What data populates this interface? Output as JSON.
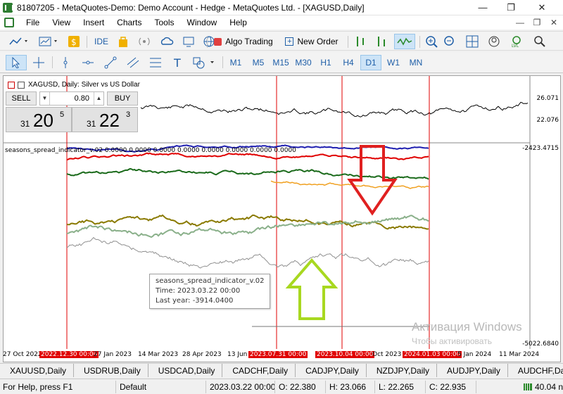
{
  "window": {
    "title": "81807205 - MetaQuotes-Demo: Demo Account - Hedge - MetaQuotes Ltd. - [XAGUSD,Daily]"
  },
  "menu": [
    "File",
    "View",
    "Insert",
    "Charts",
    "Tools",
    "Window",
    "Help"
  ],
  "toolbar": {
    "ide_label": "IDE",
    "algo_label": "Algo Trading",
    "new_order_label": "New Order",
    "timeframes": [
      "M1",
      "M5",
      "M15",
      "M30",
      "H1",
      "H4",
      "D1",
      "W1",
      "MN"
    ],
    "active_timeframe": "D1"
  },
  "chart": {
    "symbol_label": "XAGUSD, Daily:  Silver vs US Dollar",
    "indicator_label": "seasons_spread_indicator_v.02 0.0000 0.0000 0.0000 0.0000 0.0000 0.0000 0.0000 0.0000",
    "price_labels": [
      "26.071",
      "22.076",
      "-2423.4715",
      "-5022.6840"
    ],
    "x_labels": [
      {
        "text": "27 Oct 2022",
        "highlight": false
      },
      {
        "text": "2022.12.30 00:00",
        "highlight": true
      },
      {
        "text": "27 Jan 2023",
        "highlight": false
      },
      {
        "text": "14 Mar 2023",
        "highlight": false
      },
      {
        "text": "28 Apr 2023",
        "highlight": false
      },
      {
        "text": "13 Jun",
        "highlight": false
      },
      {
        "text": "2023.07.31 00:00",
        "highlight": true
      },
      {
        "text": "2023.10.04 00:00",
        "highlight": true
      },
      {
        "text": "Oct 2023",
        "highlight": false
      },
      {
        "text": "2024.01.03 00:00",
        "highlight": true
      },
      {
        "text": "5 Jan 2024",
        "highlight": false
      },
      {
        "text": "11 Mar 2024",
        "highlight": false
      }
    ]
  },
  "trade": {
    "sell_label": "SELL",
    "buy_label": "BUY",
    "lot": "0.80",
    "sell_small": "31",
    "sell_big": "20",
    "sell_sup": "5",
    "buy_small": "31",
    "buy_big": "22",
    "buy_sup": "3"
  },
  "tooltip": {
    "line1": "seasons_spread_indicator_v.02",
    "line2": "Time: 2023.03.22 00:00",
    "line3": "Last year: -3914.0400"
  },
  "watermark": {
    "line1": "Активация Windows",
    "line2": "Чтобы активировать"
  },
  "tabs": [
    "XAUUSD,Daily",
    "USDRUB,Daily",
    "USDCAD,Daily",
    "CADCHF,Daily",
    "CADJPY,Daily",
    "NZDJPY,Daily",
    "AUDJPY,Daily",
    "AUDCHF,Da"
  ],
  "status": {
    "help": "For Help, press F1",
    "profile": "Default",
    "time": "2023.03.22 00:00",
    "open": "O: 22.380",
    "high": "H: 23.066",
    "low": "L: 22.265",
    "close": "C: 22.935",
    "net": "40.04 n"
  },
  "colors": {
    "blue": "#1f1fb0",
    "red": "#e00000",
    "orange": "#f0a020",
    "green": "#1a6a1a",
    "olive": "#8a7a00",
    "sage": "#8ab08a",
    "gray": "#909090",
    "arrow_red": "#e02020",
    "arrow_green": "#a8d820"
  }
}
